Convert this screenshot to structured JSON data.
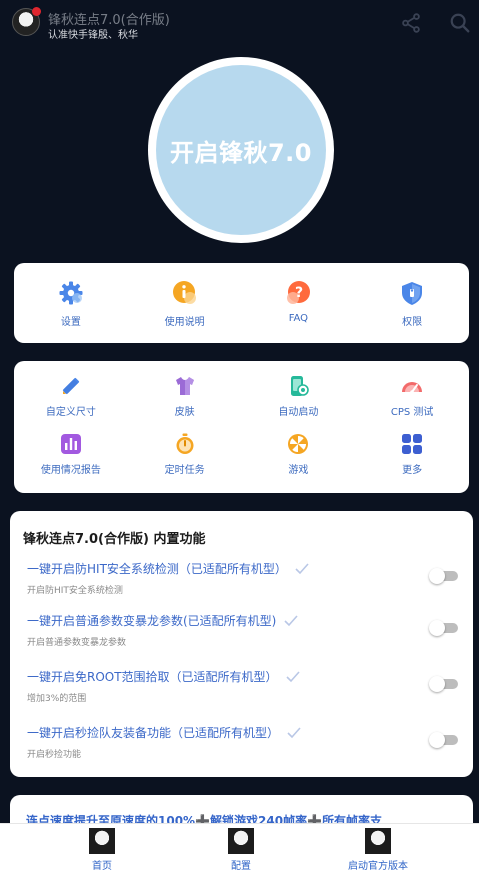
{
  "header": {
    "title": "锋秋连点7.0(合作版)",
    "subtitle": "认准快手锋殷、秋华",
    "icons": [
      "share-icon",
      "search-icon"
    ]
  },
  "main_button": {
    "label": "开启锋秋7.0"
  },
  "quick_menu": [
    {
      "label": "设置",
      "icon": "gear-icon"
    },
    {
      "label": "使用说明",
      "icon": "info-icon"
    },
    {
      "label": "FAQ",
      "icon": "question-icon"
    },
    {
      "label": "权限",
      "icon": "shield-icon"
    }
  ],
  "tools": [
    {
      "label": "自定义尺寸",
      "icon": "ruler-pencil-icon"
    },
    {
      "label": "皮肤",
      "icon": "shirt-icon"
    },
    {
      "label": "自动启动",
      "icon": "phone-icon"
    },
    {
      "label": "CPS 测试",
      "icon": "speedometer-icon"
    },
    {
      "label": "使用情况报告",
      "icon": "bar-chart-icon"
    },
    {
      "label": "定时任务",
      "icon": "stopwatch-icon"
    },
    {
      "label": "游戏",
      "icon": "pinwheel-icon"
    },
    {
      "label": "更多",
      "icon": "grid-icon"
    }
  ],
  "features": {
    "title": "锋秋连点7.0(合作版) 内置功能",
    "items": [
      {
        "title": "一键开启防HIT安全系统检测（已适配所有机型）",
        "desc": "开启防HIT安全系统检测",
        "enabled": false
      },
      {
        "title": "一键开启普通参数变暴龙参数(已适配所有机型)",
        "desc": "开启普通参数变暴龙参数",
        "enabled": false
      },
      {
        "title": "一键开启免ROOT范围拾取（已适配所有机型）",
        "desc": "增加3%的范围",
        "enabled": false
      },
      {
        "title": "一键开启秒捡队友装备功能（已适配所有机型）",
        "desc": "开启秒捡功能",
        "enabled": false
      }
    ]
  },
  "banner": {
    "text": "连点速度提升至原速度的100%➕解锁游戏240帧率➕所有帧率支"
  },
  "bottom_nav": [
    {
      "label": "首页"
    },
    {
      "label": "配置"
    },
    {
      "label": "启动官方版本"
    }
  ],
  "colors": {
    "background": "#0b1220",
    "accent": "#3b68c8",
    "main_button": "#b7d9ee"
  }
}
